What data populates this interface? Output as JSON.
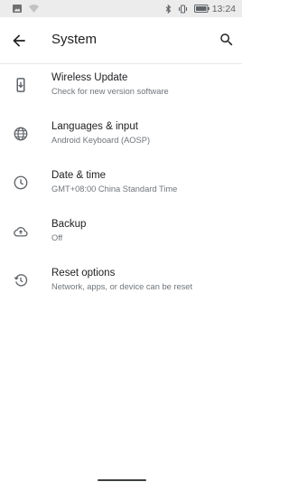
{
  "status_bar": {
    "time": "13:24"
  },
  "app_bar": {
    "title": "System"
  },
  "items": [
    {
      "label": "Wireless Update",
      "sub": "Check for new version software",
      "icon": "system-update-icon"
    },
    {
      "label": "Languages & input",
      "sub": "Android Keyboard (AOSP)",
      "icon": "globe-icon"
    },
    {
      "label": "Date & time",
      "sub": "GMT+08:00 China Standard Time",
      "icon": "clock-icon"
    },
    {
      "label": "Backup",
      "sub": "Off",
      "icon": "cloud-upload-icon"
    },
    {
      "label": "Reset options",
      "sub": "Network, apps, or device can be reset",
      "icon": "restore-icon"
    }
  ],
  "colors": {
    "status_bar_bg": "#ececec",
    "icon": "#5f6368",
    "subtext": "#70757a"
  }
}
